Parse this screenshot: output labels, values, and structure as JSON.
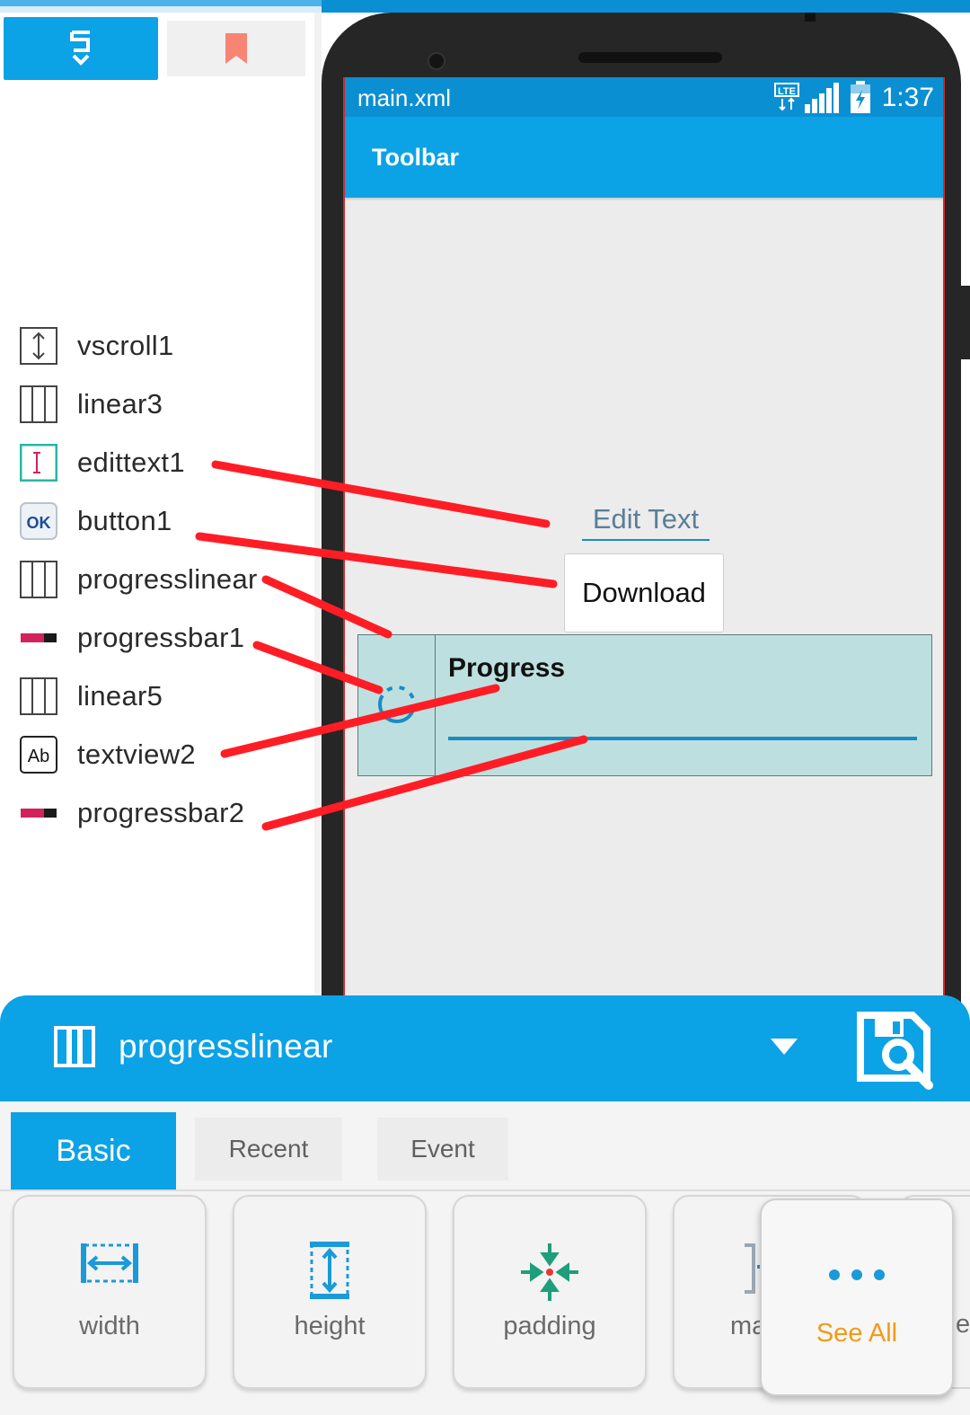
{
  "colors": {
    "accent": "#0ca2e6",
    "status_bar": "#0b8fd3",
    "annotation": "#ff1d25",
    "see_all": "#f29a18",
    "progress_bg": "#bddfdf"
  },
  "left_panel": {
    "tabs": [
      {
        "icon": "component-tree-icon"
      },
      {
        "icon": "bookmark-icon"
      }
    ],
    "tree": [
      {
        "icon": "vscroll-icon",
        "label": "vscroll1"
      },
      {
        "icon": "linear-layout-icon",
        "label": "linear3"
      },
      {
        "icon": "edittext-icon",
        "label": "edittext1"
      },
      {
        "icon": "button-ok-icon",
        "label": "button1"
      },
      {
        "icon": "linear-layout-icon",
        "label": "progresslinear"
      },
      {
        "icon": "progressbar-icon",
        "label": "progressbar1"
      },
      {
        "icon": "linear-layout-icon",
        "label": "linear5"
      },
      {
        "icon": "textview-icon",
        "label": "textview2"
      },
      {
        "icon": "progressbar-icon",
        "label": "progressbar2"
      }
    ]
  },
  "phone": {
    "status": {
      "title": "main.xml",
      "time": "1:37",
      "network": "LTE"
    },
    "toolbar_title": "Toolbar",
    "edit_text": "Edit Text",
    "download_button": "Download",
    "progress_title": "Progress"
  },
  "bottom_sheet": {
    "selected_component": "progresslinear",
    "tabs": [
      "Basic",
      "Recent",
      "Event"
    ],
    "active_tab": "Basic",
    "tools": [
      {
        "label": "width",
        "icon": "width-icon"
      },
      {
        "label": "height",
        "icon": "height-icon"
      },
      {
        "label": "padding",
        "icon": "padding-icon"
      },
      {
        "label": "ma",
        "icon": "margin-icon"
      }
    ],
    "see_all": "See All"
  }
}
